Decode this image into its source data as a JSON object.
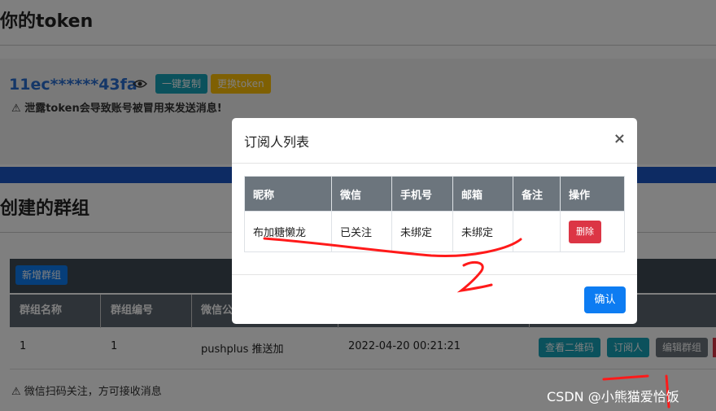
{
  "page": {
    "heading_token": "你的token",
    "token_value": "11ec******43fa",
    "copy_btn": "一键复制",
    "change_btn": "更换token",
    "token_warning": "泄露token会导致账号被冒用来发送消息!",
    "heading_groups": "创建的群组",
    "add_group_btn": "新增群组",
    "group_table": {
      "headers": [
        "群组名称",
        "群组编号",
        "微信公"
      ],
      "row": {
        "name": "1",
        "code": "1",
        "wechat": "pushplus 推送加",
        "time": "2022-04-20 00:21:21",
        "actions": [
          "查看二维码",
          "订阅人",
          "编辑群组"
        ]
      }
    },
    "scan_note": "微信扫码关注，方可接收消息"
  },
  "modal": {
    "title": "订阅人列表",
    "close_symbol": "×",
    "headers": [
      "昵称",
      "微信",
      "手机号",
      "邮箱",
      "备注",
      "操作"
    ],
    "rows": [
      {
        "nickname": "布加糖懒龙",
        "wechat": "已关注",
        "phone": "未绑定",
        "email": "未绑定",
        "note": "",
        "action": "删除"
      }
    ],
    "confirm_btn": "确认"
  },
  "watermark": "CSDN @小熊猫爱恰饭",
  "annotation_text": "2",
  "colors": {
    "link_blue": "#2a6fd1",
    "teal": "#17a2b8",
    "yellow": "#ffc107",
    "primary": "#0d7cf2",
    "danger": "#dc3545",
    "annotation_red": "#ff1a1a"
  },
  "icons": [
    "eye-icon",
    "warning-icon",
    "close-icon"
  ]
}
